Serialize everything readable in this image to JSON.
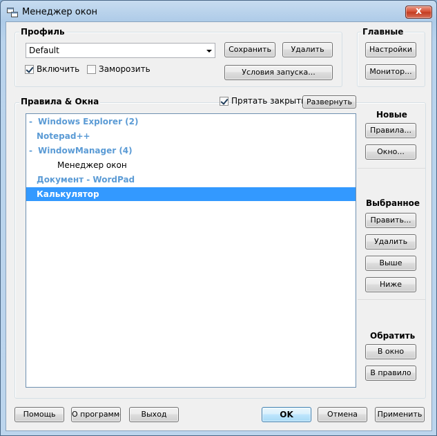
{
  "window": {
    "title": "Менеджер окон",
    "close_label": "x"
  },
  "profile": {
    "title": "Профиль",
    "selected_value": "Default",
    "save_label": "Сохранить",
    "delete_label": "Удалить",
    "startup_label": "Условия запуска...",
    "enable_label": "Включить",
    "enable_checked": true,
    "freeze_label": "Заморозить",
    "freeze_checked": false
  },
  "main_group": {
    "title": "Главные",
    "settings_label": "Настройки",
    "monitor_label": "Монитор..."
  },
  "rules": {
    "title": "Правила & Окна",
    "hide_closed_label": "Прятать закрытые",
    "hide_closed_checked": true,
    "expand_label": "Развернуть",
    "items": [
      {
        "prefix": "-",
        "text": "Windows Explorer (2)",
        "kind": "group"
      },
      {
        "prefix": "",
        "text": "Notepad++",
        "kind": "group"
      },
      {
        "prefix": "-",
        "text": "WindowManager (4)",
        "kind": "group"
      },
      {
        "prefix": "",
        "text": "Менеджер окон",
        "kind": "plain"
      },
      {
        "prefix": "",
        "text": "Документ - WordPad",
        "kind": "group"
      },
      {
        "prefix": "",
        "text": "Калькулятор",
        "kind": "selected"
      }
    ]
  },
  "new_section": {
    "title": "Новые",
    "rule_label": "Правила...",
    "window_label": "Окно..."
  },
  "selected_section": {
    "title": "Выбранное",
    "edit_label": "Править...",
    "delete_label": "Удалить",
    "up_label": "Выше",
    "down_label": "Ниже"
  },
  "reverse_section": {
    "title": "Обратить",
    "to_window_label": "В окно",
    "to_rule_label": "В правило"
  },
  "footer": {
    "help_label": "Помощь",
    "about_label": "О программе",
    "exit_label": "Выход",
    "ok_label": "OK",
    "cancel_label": "Отмена",
    "apply_label": "Применить"
  },
  "colors": {
    "group_text": "#5b9bd5",
    "selection": "#3399ff"
  }
}
